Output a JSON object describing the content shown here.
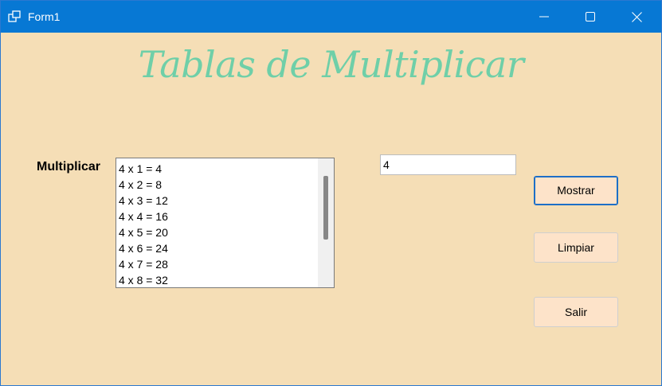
{
  "window": {
    "title": "Form1",
    "controls": [
      "minimize-icon",
      "maximize-icon",
      "close-icon"
    ]
  },
  "header": {
    "title": "Tablas de Multiplicar"
  },
  "form": {
    "label": "Multiplicar",
    "input_value": "4",
    "list_items": [
      "4 x 1 = 4",
      "4 x 2 = 8",
      "4 x 3 = 12",
      "4 x 4 = 16",
      "4 x 5 = 20",
      "4 x 6 = 24",
      "4 x 7 = 28",
      "4 x 8 = 32"
    ]
  },
  "buttons": {
    "show": "Mostrar",
    "clear": "Limpiar",
    "exit": "Salir"
  },
  "colors": {
    "titlebar": "#0778d4",
    "background": "#f5deb6",
    "heading": "#6fcfa8",
    "button": "#fde3c9"
  }
}
